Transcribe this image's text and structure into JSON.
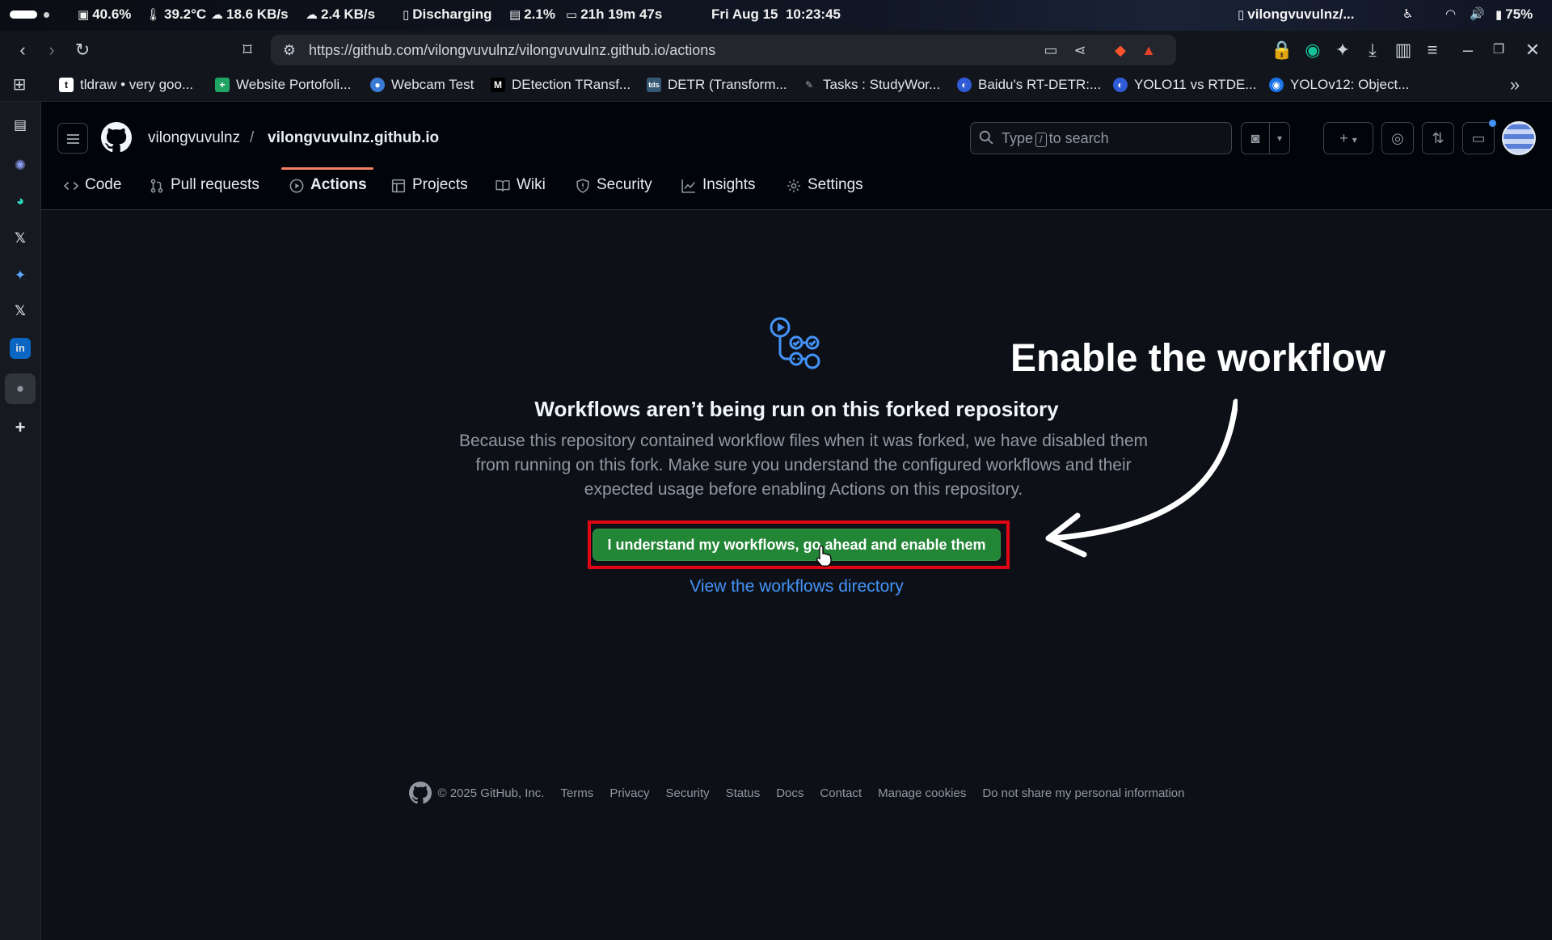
{
  "os_bar": {
    "cpu": "40.6%",
    "temp": "39.2°C",
    "down": "18.6 KB/s",
    "up": "2.4 KB/s",
    "battery_status": "Discharging",
    "mem": "2.1%",
    "uptime": "21h 19m 47s",
    "clock": "Fri Aug 15  10:23:45",
    "window_title": "vilongvuvulnz/...",
    "battery": "75%"
  },
  "browser": {
    "url": "https://github.com/vilongvuvulnz/vilongvuvulnz.github.io/actions",
    "bookmarks": [
      {
        "label": "tldraw • very goo...",
        "icon": "tldraw-icon",
        "color": "#ffffff"
      },
      {
        "label": "Website Portofoli...",
        "icon": "sheets-icon",
        "color": "#1fa463"
      },
      {
        "label": "Webcam Test",
        "icon": "webcam-icon",
        "color": "#3a7bd5"
      },
      {
        "label": "DEtection TRansf...",
        "icon": "medium-icon",
        "color": "#000000"
      },
      {
        "label": "DETR (Transform...",
        "icon": "tds-icon",
        "color": "#355876"
      },
      {
        "label": "Tasks : StudyWor...",
        "icon": "studyworld-icon",
        "color": "#444444"
      },
      {
        "label": "Baidu's RT-DETR:...",
        "icon": "baidu-icon",
        "color": "#2f5bd6"
      },
      {
        "label": "YOLO11 vs RTDE...",
        "icon": "ultralytics-icon",
        "color": "#2f5bd6"
      },
      {
        "label": "YOLOv12: Object...",
        "icon": "yolo-icon",
        "color": "#1a73e8"
      }
    ]
  },
  "github": {
    "owner": "vilongvuvulnz",
    "separator": "/",
    "repo": "vilongvuvulnz.github.io",
    "search_prefix": "Type",
    "search_key": "/",
    "search_suffix": "to search",
    "tabs": [
      {
        "label": "Code",
        "icon": "code-icon"
      },
      {
        "label": "Pull requests",
        "icon": "pull-request-icon"
      },
      {
        "label": "Actions",
        "icon": "play-icon"
      },
      {
        "label": "Projects",
        "icon": "table-icon"
      },
      {
        "label": "Wiki",
        "icon": "book-icon"
      },
      {
        "label": "Security",
        "icon": "shield-icon"
      },
      {
        "label": "Insights",
        "icon": "graph-icon"
      },
      {
        "label": "Settings",
        "icon": "gear-icon"
      }
    ],
    "active_tab": "Actions"
  },
  "blankslate": {
    "title": "Workflows aren’t being run on this forked repository",
    "description": "Because this repository contained workflow files when it was forked, we have disabled them from running on this fork. Make sure you understand the configured workflows and their expected usage before enabling Actions on this repository.",
    "enable_button": "I understand my workflows, go ahead and enable them",
    "view_link": "View the workflows directory"
  },
  "annotation": {
    "text": "Enable the workflow",
    "highlight_color": "#e10613"
  },
  "footer": {
    "copyright": "© 2025 GitHub, Inc.",
    "links": [
      "Terms",
      "Privacy",
      "Security",
      "Status",
      "Docs",
      "Contact",
      "Manage cookies",
      "Do not share my personal information"
    ]
  },
  "colors": {
    "accent_green": "#238636",
    "link_blue": "#4493f8",
    "tab_underline": "#f78166"
  }
}
